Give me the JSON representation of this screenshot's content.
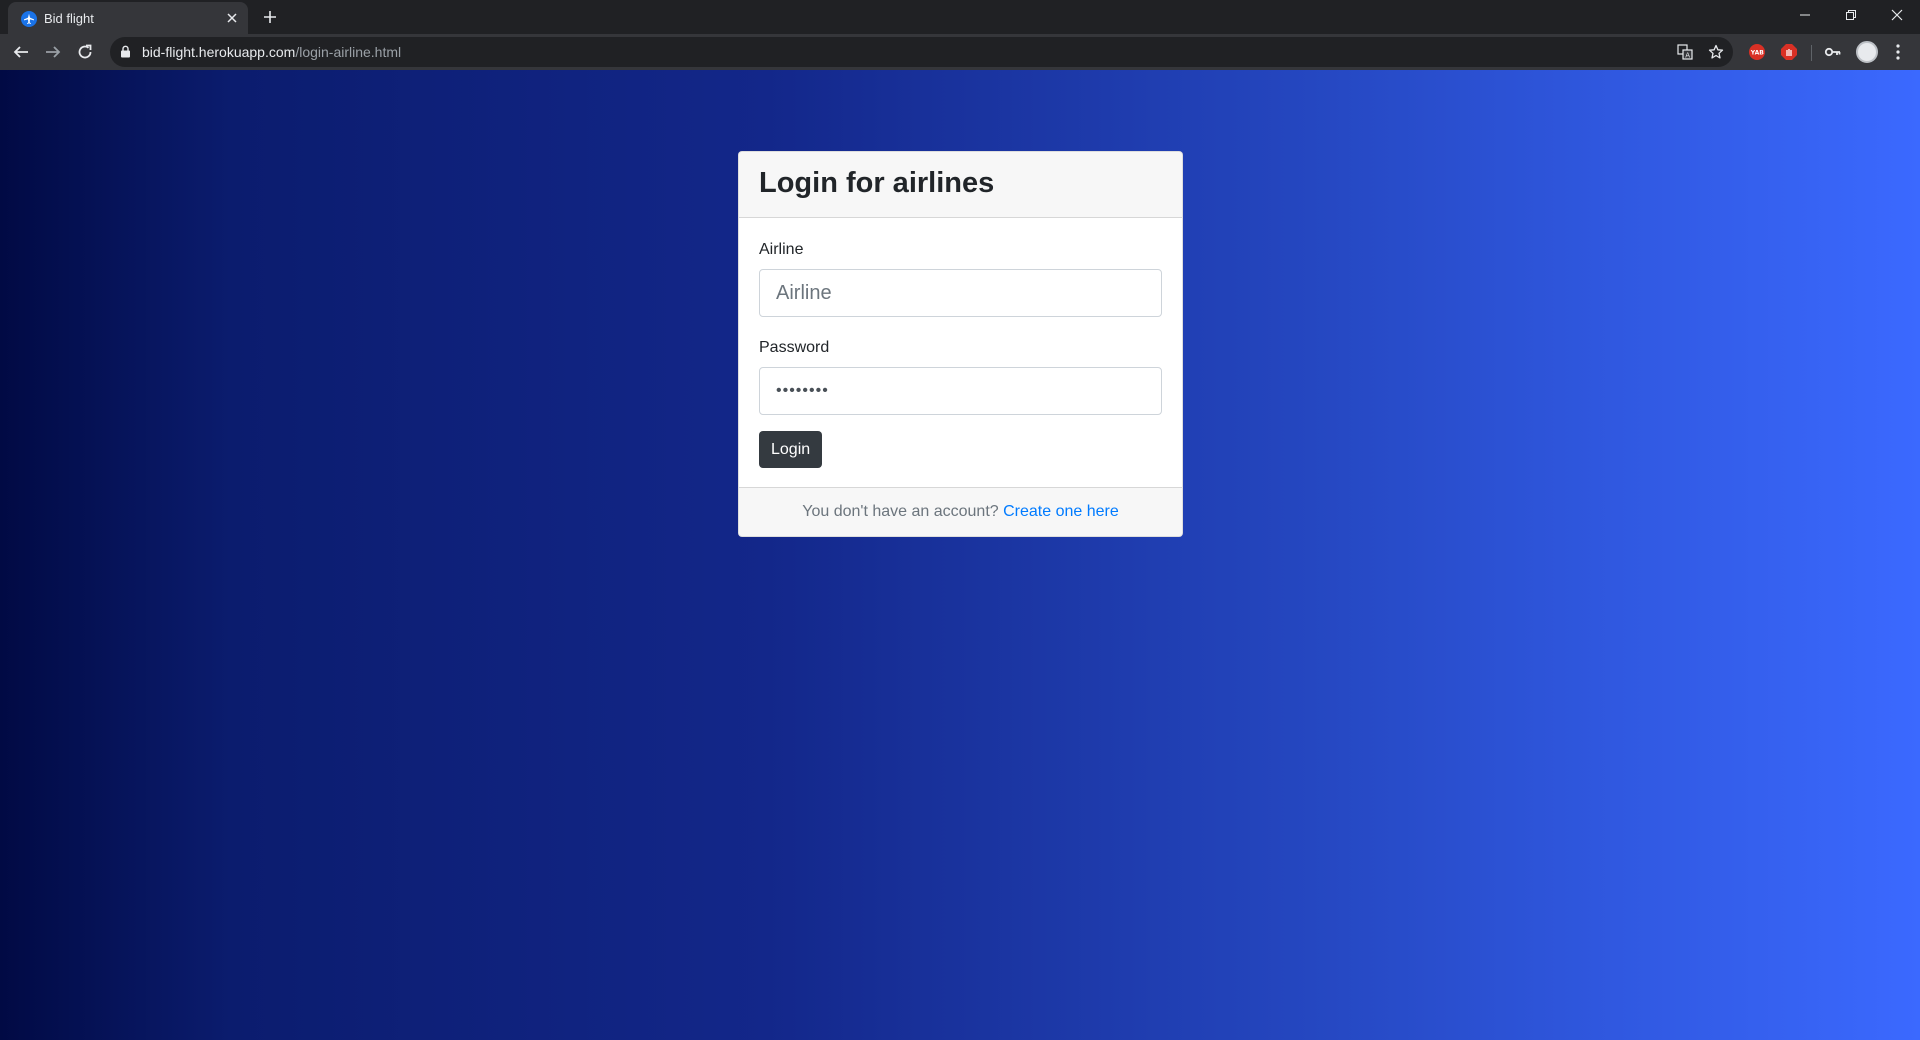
{
  "browser": {
    "tab": {
      "title": "Bid flight",
      "favicon": "airplane-icon"
    },
    "url": {
      "host": "bid-flight.herokuapp.com",
      "path": "/login-airline.html"
    },
    "extensions": [
      {
        "name": "yab-extension-icon",
        "label": "YAB",
        "color": "#d93025"
      },
      {
        "name": "adblock-extension-icon",
        "color": "#d93025"
      }
    ]
  },
  "login": {
    "title": "Login for airlines",
    "airline_label": "Airline",
    "airline_placeholder": "Airline",
    "password_label": "Password",
    "password_value": "••••••••",
    "submit_label": "Login",
    "footer_text": "You don't have an account?",
    "footer_link": "Create one here"
  },
  "colors": {
    "gradient_start": "#010a44",
    "gradient_end": "#3b69ff",
    "button": "#343a40",
    "link": "#007bff"
  }
}
